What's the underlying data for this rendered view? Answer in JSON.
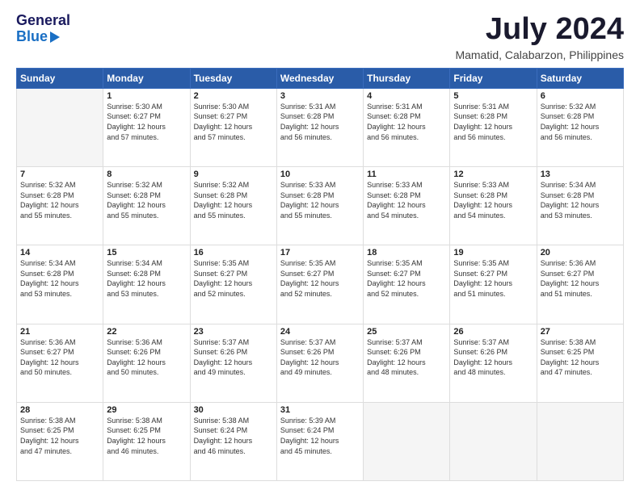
{
  "header": {
    "logo_line1": "General",
    "logo_line2": "Blue",
    "month_year": "July 2024",
    "location": "Mamatid, Calabarzon, Philippines"
  },
  "days_of_week": [
    "Sunday",
    "Monday",
    "Tuesday",
    "Wednesday",
    "Thursday",
    "Friday",
    "Saturday"
  ],
  "weeks": [
    [
      {
        "day": "",
        "info": ""
      },
      {
        "day": "1",
        "info": "Sunrise: 5:30 AM\nSunset: 6:27 PM\nDaylight: 12 hours\nand 57 minutes."
      },
      {
        "day": "2",
        "info": "Sunrise: 5:30 AM\nSunset: 6:27 PM\nDaylight: 12 hours\nand 57 minutes."
      },
      {
        "day": "3",
        "info": "Sunrise: 5:31 AM\nSunset: 6:28 PM\nDaylight: 12 hours\nand 56 minutes."
      },
      {
        "day": "4",
        "info": "Sunrise: 5:31 AM\nSunset: 6:28 PM\nDaylight: 12 hours\nand 56 minutes."
      },
      {
        "day": "5",
        "info": "Sunrise: 5:31 AM\nSunset: 6:28 PM\nDaylight: 12 hours\nand 56 minutes."
      },
      {
        "day": "6",
        "info": "Sunrise: 5:32 AM\nSunset: 6:28 PM\nDaylight: 12 hours\nand 56 minutes."
      }
    ],
    [
      {
        "day": "7",
        "info": "Sunrise: 5:32 AM\nSunset: 6:28 PM\nDaylight: 12 hours\nand 55 minutes."
      },
      {
        "day": "8",
        "info": "Sunrise: 5:32 AM\nSunset: 6:28 PM\nDaylight: 12 hours\nand 55 minutes."
      },
      {
        "day": "9",
        "info": "Sunrise: 5:32 AM\nSunset: 6:28 PM\nDaylight: 12 hours\nand 55 minutes."
      },
      {
        "day": "10",
        "info": "Sunrise: 5:33 AM\nSunset: 6:28 PM\nDaylight: 12 hours\nand 55 minutes."
      },
      {
        "day": "11",
        "info": "Sunrise: 5:33 AM\nSunset: 6:28 PM\nDaylight: 12 hours\nand 54 minutes."
      },
      {
        "day": "12",
        "info": "Sunrise: 5:33 AM\nSunset: 6:28 PM\nDaylight: 12 hours\nand 54 minutes."
      },
      {
        "day": "13",
        "info": "Sunrise: 5:34 AM\nSunset: 6:28 PM\nDaylight: 12 hours\nand 53 minutes."
      }
    ],
    [
      {
        "day": "14",
        "info": "Sunrise: 5:34 AM\nSunset: 6:28 PM\nDaylight: 12 hours\nand 53 minutes."
      },
      {
        "day": "15",
        "info": "Sunrise: 5:34 AM\nSunset: 6:28 PM\nDaylight: 12 hours\nand 53 minutes."
      },
      {
        "day": "16",
        "info": "Sunrise: 5:35 AM\nSunset: 6:27 PM\nDaylight: 12 hours\nand 52 minutes."
      },
      {
        "day": "17",
        "info": "Sunrise: 5:35 AM\nSunset: 6:27 PM\nDaylight: 12 hours\nand 52 minutes."
      },
      {
        "day": "18",
        "info": "Sunrise: 5:35 AM\nSunset: 6:27 PM\nDaylight: 12 hours\nand 52 minutes."
      },
      {
        "day": "19",
        "info": "Sunrise: 5:35 AM\nSunset: 6:27 PM\nDaylight: 12 hours\nand 51 minutes."
      },
      {
        "day": "20",
        "info": "Sunrise: 5:36 AM\nSunset: 6:27 PM\nDaylight: 12 hours\nand 51 minutes."
      }
    ],
    [
      {
        "day": "21",
        "info": "Sunrise: 5:36 AM\nSunset: 6:27 PM\nDaylight: 12 hours\nand 50 minutes."
      },
      {
        "day": "22",
        "info": "Sunrise: 5:36 AM\nSunset: 6:26 PM\nDaylight: 12 hours\nand 50 minutes."
      },
      {
        "day": "23",
        "info": "Sunrise: 5:37 AM\nSunset: 6:26 PM\nDaylight: 12 hours\nand 49 minutes."
      },
      {
        "day": "24",
        "info": "Sunrise: 5:37 AM\nSunset: 6:26 PM\nDaylight: 12 hours\nand 49 minutes."
      },
      {
        "day": "25",
        "info": "Sunrise: 5:37 AM\nSunset: 6:26 PM\nDaylight: 12 hours\nand 48 minutes."
      },
      {
        "day": "26",
        "info": "Sunrise: 5:37 AM\nSunset: 6:26 PM\nDaylight: 12 hours\nand 48 minutes."
      },
      {
        "day": "27",
        "info": "Sunrise: 5:38 AM\nSunset: 6:25 PM\nDaylight: 12 hours\nand 47 minutes."
      }
    ],
    [
      {
        "day": "28",
        "info": "Sunrise: 5:38 AM\nSunset: 6:25 PM\nDaylight: 12 hours\nand 47 minutes."
      },
      {
        "day": "29",
        "info": "Sunrise: 5:38 AM\nSunset: 6:25 PM\nDaylight: 12 hours\nand 46 minutes."
      },
      {
        "day": "30",
        "info": "Sunrise: 5:38 AM\nSunset: 6:24 PM\nDaylight: 12 hours\nand 46 minutes."
      },
      {
        "day": "31",
        "info": "Sunrise: 5:39 AM\nSunset: 6:24 PM\nDaylight: 12 hours\nand 45 minutes."
      },
      {
        "day": "",
        "info": ""
      },
      {
        "day": "",
        "info": ""
      },
      {
        "day": "",
        "info": ""
      }
    ]
  ]
}
